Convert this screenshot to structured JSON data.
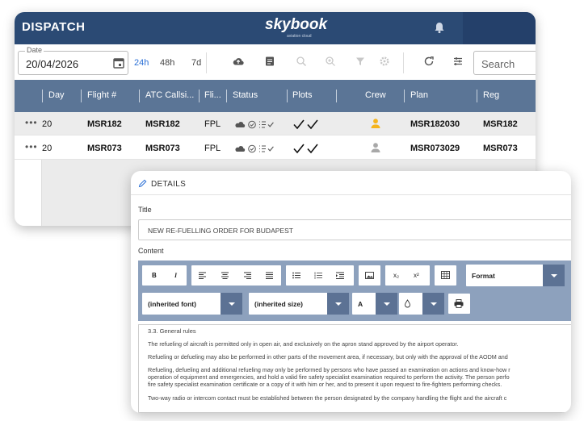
{
  "dispatch": {
    "title": "DISPATCH",
    "logo": "skybook",
    "logo_sub": "aviation cloud",
    "date": {
      "label": "Date",
      "value": "20/04/2026"
    },
    "ranges": [
      "24h",
      "48h",
      "7d"
    ],
    "active_range": "24h",
    "search_placeholder": "Search",
    "columns": [
      "Day",
      "Flight #",
      "ATC Callsi...",
      "Fli...",
      "Status",
      "Plots",
      "Crew",
      "Plan",
      "Reg"
    ],
    "rows": [
      {
        "menu": "•••",
        "day": "20",
        "flight": "MSR182",
        "atc": "MSR182",
        "type": "FPL",
        "plan": "MSR182030",
        "reg": "MSR182",
        "crew_color": "#f5b41c"
      },
      {
        "menu": "•••",
        "day": "20",
        "flight": "MSR073",
        "atc": "MSR073",
        "type": "FPL",
        "plan": "MSR073029",
        "reg": "MSR073",
        "crew_color": "#a8a8a8"
      }
    ]
  },
  "details": {
    "header": "DETAILS",
    "title_label": "Title",
    "title_value": "NEW RE-FUELLING ORDER FOR BUDAPEST",
    "content_label": "Content",
    "toolbar": {
      "bold": "B",
      "italic": "I",
      "subscript": "x₂",
      "superscript": "x²",
      "format": "Format",
      "font": "(inherited font)",
      "size": "(inherited size)",
      "text_color": "A"
    },
    "content": [
      "3.3. General rules",
      "The refueling of aircraft is permitted only in open air, and exclusively on the apron stand approved by the airport operator.",
      "Refueling or defueling may also be performed in other parts of the movement area, if necessary, but only with the approval of the AODM and",
      "Refueling, defueling and additional refueling may only be performed by persons who have passed an examination on actions and know-how r",
      "operation of equipment and emergencies, and hold a valid fire safety specialist examination required to perform the activity. The person perfo",
      "fire safety specialist examination certificate or a copy of it with him or her, and to present it upon request to fire-fighters performing checks.",
      "Two-way radio or intercom contact must be established between the person designated by the company handling the flight and the aircraft c"
    ]
  },
  "colors": {
    "topbar": "#2b4a74",
    "table_header": "#5b7596",
    "accent": "#2a6fd6",
    "editor_bar": "#8da1bd"
  },
  "icons": [
    "bell-icon",
    "calendar-icon",
    "cloud-upload-icon",
    "note-icon",
    "zoom-out-icon",
    "zoom-in-icon",
    "filter-icon",
    "gear-icon",
    "refresh-icon",
    "settings-sliders-icon",
    "person-icon",
    "pencil-icon",
    "print-icon"
  ]
}
